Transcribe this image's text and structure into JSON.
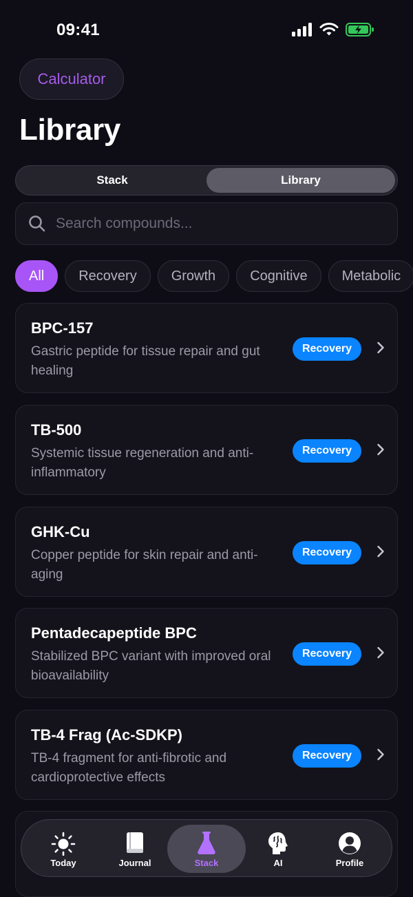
{
  "status": {
    "time": "09:41"
  },
  "header": {
    "calculator_label": "Calculator",
    "title": "Library"
  },
  "segments": [
    {
      "label": "Stack",
      "active": false
    },
    {
      "label": "Library",
      "active": true
    }
  ],
  "search": {
    "placeholder": "Search compounds...",
    "value": ""
  },
  "filters": [
    {
      "label": "All",
      "active": true
    },
    {
      "label": "Recovery",
      "active": false
    },
    {
      "label": "Growth",
      "active": false
    },
    {
      "label": "Cognitive",
      "active": false
    },
    {
      "label": "Metabolic",
      "active": false
    }
  ],
  "compounds": [
    {
      "name": "BPC-157",
      "description": "Gastric peptide for tissue repair and gut healing",
      "category": "Recovery"
    },
    {
      "name": "TB-500",
      "description": "Systemic tissue regeneration and anti-inflammatory",
      "category": "Recovery"
    },
    {
      "name": "GHK-Cu",
      "description": "Copper peptide for skin repair and anti-aging",
      "category": "Recovery"
    },
    {
      "name": "Pentadecapeptide BPC",
      "description": "Stabilized BPC variant with improved oral bioavailability",
      "category": "Recovery"
    },
    {
      "name": "TB-4 Frag (Ac-SDKP)",
      "description": "TB-4 fragment for anti-fibrotic and cardioprotective effects",
      "category": "Recovery"
    }
  ],
  "tabbar": {
    "items": [
      {
        "label": "Today",
        "icon": "sun-icon",
        "active": false
      },
      {
        "label": "Journal",
        "icon": "book-icon",
        "active": false
      },
      {
        "label": "Stack",
        "icon": "flask-icon",
        "active": true
      },
      {
        "label": "AI",
        "icon": "brain-icon",
        "active": false
      },
      {
        "label": "Profile",
        "icon": "person-icon",
        "active": false
      }
    ]
  },
  "colors": {
    "accent": "#a855f7",
    "badge": "#0a84ff",
    "background": "#0e0d15",
    "battery": "#34c759"
  }
}
